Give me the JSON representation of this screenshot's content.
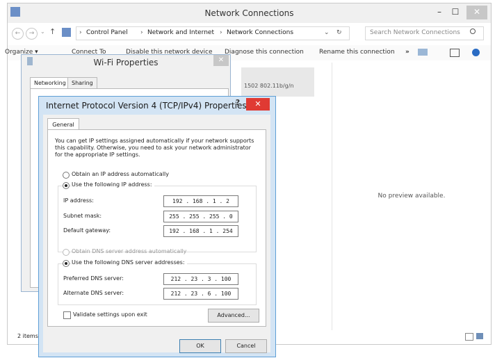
{
  "explorer": {
    "title": "Network Connections",
    "controls": {
      "min": "–",
      "max": "☐",
      "close": "✕"
    },
    "nav": {
      "back": "←",
      "forward": "→",
      "dropdown": "⌄",
      "up": "↑"
    },
    "address": {
      "parts": [
        "Control Panel",
        "Network and Internet",
        "Network Connections"
      ],
      "separator": "›"
    },
    "refresh": "↻",
    "search_placeholder": "Search Network Connections",
    "toolbar": {
      "items": [
        "Organize ▾",
        "Connect To",
        "Disable this network device",
        "Diagnose this connection",
        "Rename this connection"
      ],
      "more": "»"
    },
    "adapter_detail": "1502 802.11b/g/n",
    "preview_text": "No preview available.",
    "status": "2 items"
  },
  "wifi": {
    "title": "Wi-Fi Properties",
    "tabs": [
      "Networking",
      "Sharing"
    ],
    "close": "✕"
  },
  "ipv4": {
    "title": "Internet Protocol Version 4 (TCP/IPv4) Properties",
    "help": "?",
    "close": "✕",
    "tab": "General",
    "description": "You can get IP settings assigned automatically if your network supports this capability. Otherwise, you need to ask your network administrator for the appropriate IP settings.",
    "ip_auto_label": "Obtain an IP address automatically",
    "ip_manual_label": "Use the following IP address:",
    "fields": {
      "ip_label": "IP address:",
      "ip_value": "192 . 168 . 1 . 2",
      "mask_label": "Subnet mask:",
      "mask_value": "255 . 255 . 255 . 0",
      "gateway_label": "Default gateway:",
      "gateway_value": "192 . 168 . 1 . 254"
    },
    "dns_auto_label": "Obtain DNS server address automatically",
    "dns_manual_label": "Use the following DNS server addresses:",
    "dns": {
      "preferred_label": "Preferred DNS server:",
      "preferred_value": "212 . 23 . 3 . 100",
      "alternate_label": "Alternate DNS server:",
      "alternate_value": "212 . 23 . 6 . 100"
    },
    "validate_label": "Validate settings upon exit",
    "advanced_label": "Advanced...",
    "ok_label": "OK",
    "cancel_label": "Cancel"
  }
}
